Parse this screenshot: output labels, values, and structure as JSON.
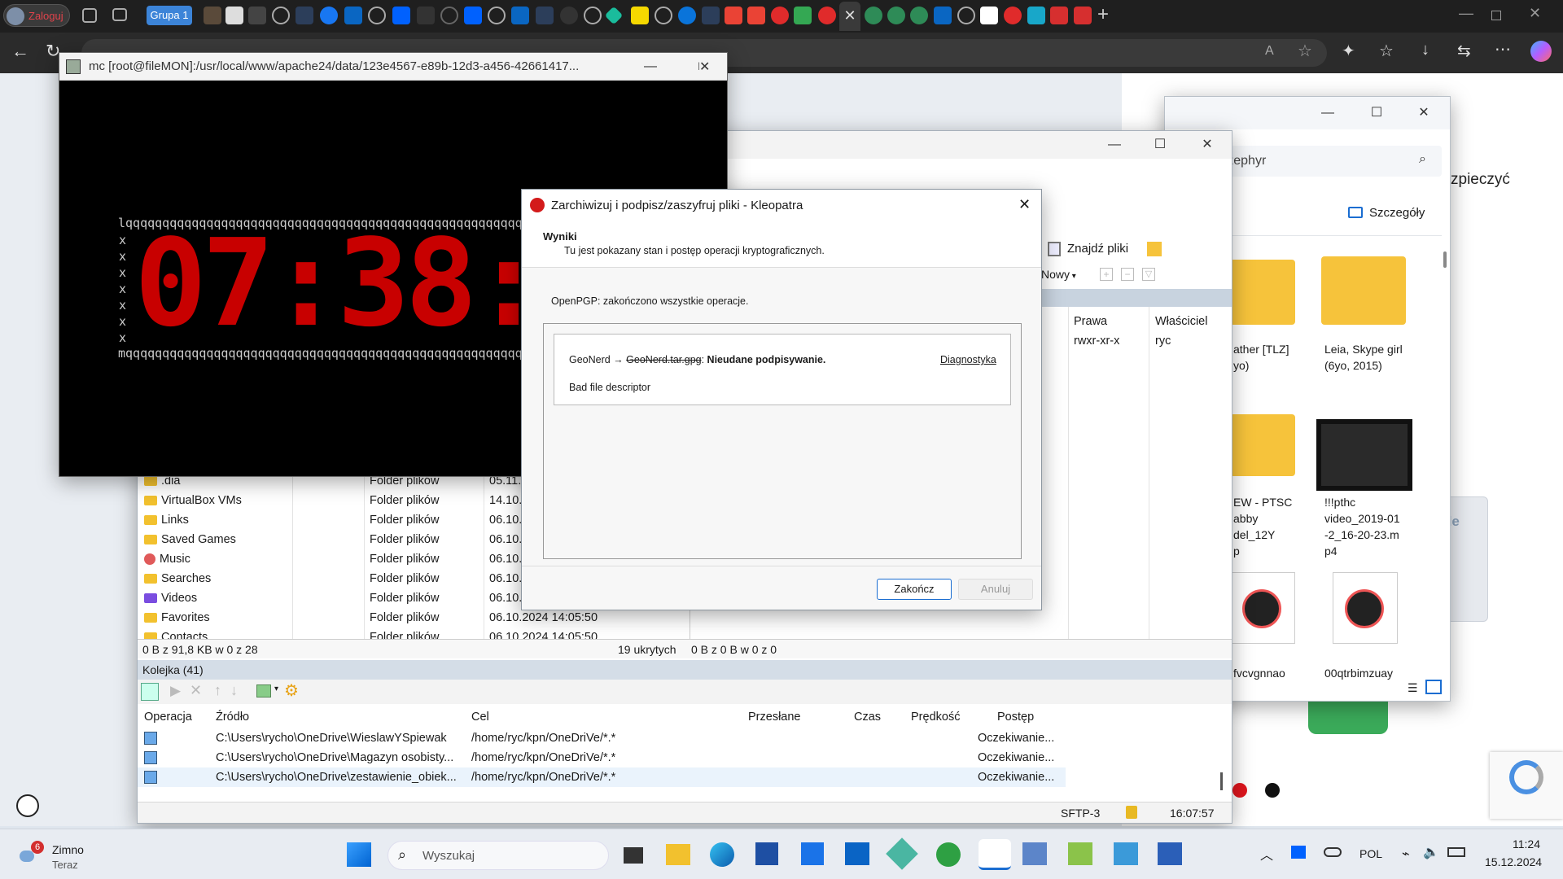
{
  "browser": {
    "login_label": "Zaloguj",
    "group_label": "Grupa 1"
  },
  "mc": {
    "title": "mc [root@fileMON]:/usr/local/www/apache24/data/123e4567-e89b-12d3-a456-42661417...",
    "top_line": "lqqqqqqqqqqqqqqqqqqqqqqqqqqqqqqqqqqqqqqqqqqqqqqqqqqqqqqqqqqqqqqqq",
    "bottom_line": "mqqqqqqqqqqqqqqqqqqqqqqqqqqqqqqqqqqqqqqqqqqqqqqqqqqqqqqqqqqqqqqqq",
    "side_char": "x",
    "clock": "07:38:1"
  },
  "winscp": {
    "find_files": "Znajdź pliki",
    "new_label": "Nowy",
    "col_rights": "Prawa",
    "col_owner": "Właściciel",
    "right_row": {
      "rights": "rwxr-xr-x",
      "owner": "ryc"
    },
    "files": [
      {
        "name": ".dia",
        "type": "Folder plików",
        "date": "05.11."
      },
      {
        "name": "VirtualBox VMs",
        "type": "Folder plików",
        "date": "14.10."
      },
      {
        "name": "Links",
        "type": "Folder plików",
        "date": "06.10."
      },
      {
        "name": "Saved Games",
        "type": "Folder plików",
        "date": "06.10."
      },
      {
        "name": "Music",
        "type": "Folder plików",
        "date": "06.10."
      },
      {
        "name": "Searches",
        "type": "Folder plików",
        "date": "06.10."
      },
      {
        "name": "Videos",
        "type": "Folder plików",
        "date": "06.10."
      },
      {
        "name": "Favorites",
        "type": "Folder plików",
        "date": "06.10.2024 14:05:50"
      },
      {
        "name": "Contacts",
        "type": "Folder plików",
        "date": "06.10.2024 14:05:50"
      }
    ],
    "left_status": "0 B z 91,8 KB w 0 z 28",
    "hidden_count": "19 ukrytych",
    "right_status": "0 B z 0 B w 0 z 0",
    "queue_title": "Kolejka (41)",
    "queue_headers": [
      "Operacja",
      "Źródło",
      "Cel",
      "Przesłane",
      "Czas",
      "Prędkość",
      "Postęp"
    ],
    "queue_rows": [
      {
        "source": "C:\\Users\\rycho\\OneDrive\\WieslawYSpiewak",
        "target": "/home/ryc/kpn/OneDriVe/*.*",
        "progress": "Oczekiwanie..."
      },
      {
        "source": "C:\\Users\\rycho\\OneDrive\\Magazyn osobisty...",
        "target": "/home/ryc/kpn/OneDriVe/*.*",
        "progress": "Oczekiwanie..."
      },
      {
        "source": "C:\\Users\\rycho\\OneDrive\\zestawienie_obiek...",
        "target": "/home/ryc/kpn/OneDriVe/*.*",
        "progress": "Oczekiwanie..."
      }
    ],
    "protocol": "SFTP-3",
    "time": "16:07:57"
  },
  "explorer": {
    "search_text": "ukaj: zephyr",
    "details_label": "Szczegóły",
    "items": [
      {
        "label": "ather [TLZ]\nyo)"
      },
      {
        "label": "Leia, Skype girl\n(6yo, 2015)"
      },
      {
        "label": "EW - PTSC\nabby\ndel_12Y\np"
      },
      {
        "label": "!!!pthc\nvideo_2019-01\n-2_16-20-23.m\np4"
      },
      {
        "label": "fvcvgnnao"
      },
      {
        "label": "00qtrbimzuay"
      }
    ]
  },
  "page": {
    "text_fragment": "zpieczyć",
    "widget_fragment": "de"
  },
  "kleopatra": {
    "title": "Zarchiwizuj i podpisz/zaszyfruj pliki - Kleopatra",
    "section_title": "Wyniki",
    "section_sub": "Tu jest pokazany stan i postęp operacji kryptograficznych.",
    "status": "OpenPGP: zakończono wszystkie operacje.",
    "result_prefix": "GeoNerd → ",
    "result_file": "GeoNerd.tar.gpg",
    "result_sep": ": ",
    "result_status": "Nieudane podpisywanie.",
    "diagnostics": "Diagnostyka",
    "error": "Bad file descriptor",
    "finish": "Zakończ",
    "cancel": "Anuluj"
  },
  "taskbar": {
    "weather_title": "Zimno",
    "weather_sub": "Teraz",
    "weather_badge": "6",
    "search_placeholder": "Wyszukaj",
    "lang": "POL",
    "clock_time": "11:24",
    "clock_date": "15.12.2024"
  }
}
